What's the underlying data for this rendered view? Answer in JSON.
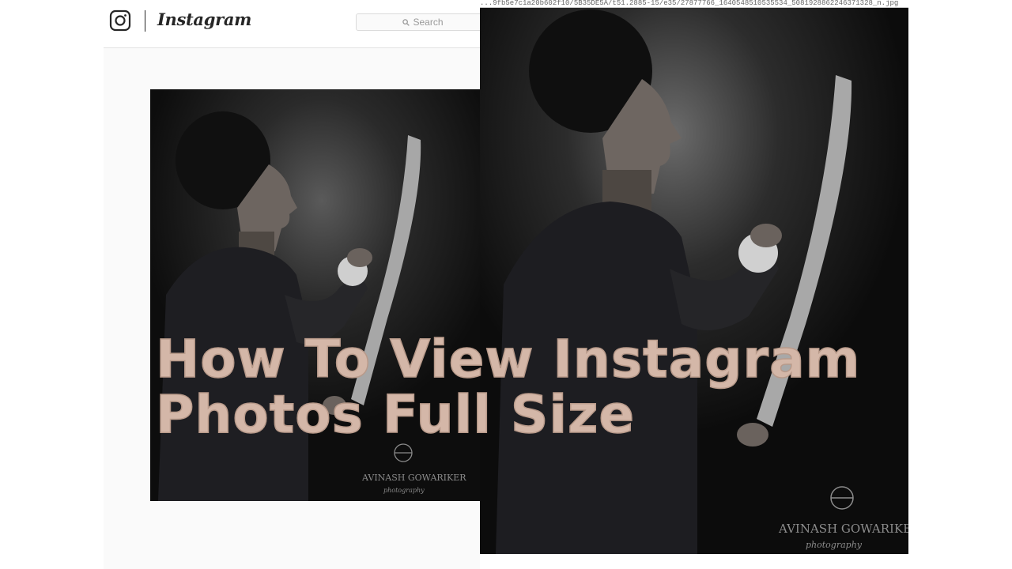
{
  "instagram": {
    "wordmark": "Instagram",
    "search": {
      "label": "Search",
      "icon": "search-icon"
    }
  },
  "browser": {
    "url_text": "...9fb5e7c1a20b602f10/5B35DE5A/t51.2885-15/e35/27877766_1640548510535534_5081928862246371328_n.jpg"
  },
  "photo": {
    "watermark": {
      "name": "AVINASH GOWARIKER",
      "sub": "photography"
    }
  },
  "overlay_title": {
    "line1": "How To View Instagram",
    "line2": "Photos Full Size"
  },
  "colors": {
    "title_fill": "#d4b7a8",
    "photo_background": "#111111"
  }
}
